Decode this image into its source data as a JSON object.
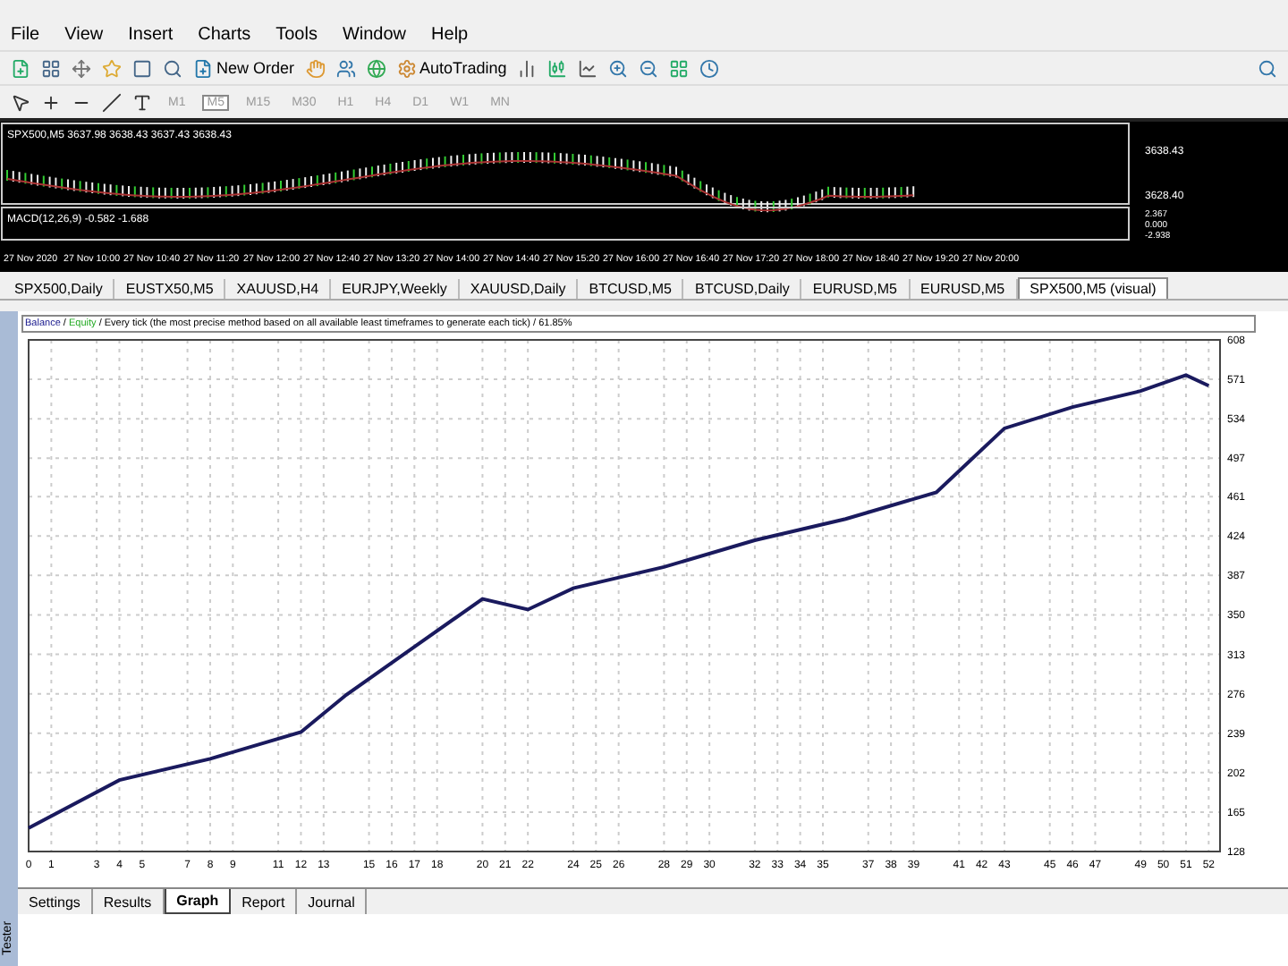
{
  "menu": [
    "File",
    "View",
    "Insert",
    "Charts",
    "Tools",
    "Window",
    "Help"
  ],
  "toolbar": {
    "new_order": "New Order",
    "autotrading": "AutoTrading"
  },
  "timeframes": [
    {
      "label": "M1",
      "selected": false
    },
    {
      "label": "M5",
      "selected": true
    },
    {
      "label": "M15",
      "selected": false
    },
    {
      "label": "M30",
      "selected": false
    },
    {
      "label": "H1",
      "selected": false
    },
    {
      "label": "H4",
      "selected": false
    },
    {
      "label": "D1",
      "selected": false
    },
    {
      "label": "W1",
      "selected": false
    },
    {
      "label": "MN",
      "selected": false
    }
  ],
  "price_chart": {
    "header": "SPX500,M5  3637.98 3638.43 3637.43 3638.43",
    "price_labels": [
      "3638.43",
      "3628.40"
    ],
    "indicator_header": "MACD(12,26,9) -0.582 -1.688",
    "indicator_labels": [
      "2.367",
      "0.000",
      "-2.938"
    ],
    "time_labels": [
      "27 Nov 2020",
      "27 Nov 10:00",
      "27 Nov 10:40",
      "27 Nov 11:20",
      "27 Nov 12:00",
      "27 Nov 12:40",
      "27 Nov 13:20",
      "27 Nov 14:00",
      "27 Nov 14:40",
      "27 Nov 15:20",
      "27 Nov 16:00",
      "27 Nov 16:40",
      "27 Nov 17:20",
      "27 Nov 18:00",
      "27 Nov 18:40",
      "27 Nov 19:20",
      "27 Nov 20:00"
    ]
  },
  "chart_tabs": [
    {
      "label": "SPX500,Daily",
      "selected": false
    },
    {
      "label": "EUSTX50,M5",
      "selected": false
    },
    {
      "label": "XAUUSD,H4",
      "selected": false
    },
    {
      "label": "EURJPY,Weekly",
      "selected": false
    },
    {
      "label": "XAUUSD,Daily",
      "selected": false
    },
    {
      "label": "BTCUSD,M5",
      "selected": false
    },
    {
      "label": "BTCUSD,Daily",
      "selected": false
    },
    {
      "label": "EURUSD,M5",
      "selected": false
    },
    {
      "label": "EURUSD,M5",
      "selected": false
    },
    {
      "label": "SPX500,M5 (visual)",
      "selected": true
    }
  ],
  "tester": {
    "side_label": "Tester",
    "graph_header": {
      "separator": "/",
      "equity": "Equity",
      "text": "/ Every tick (the most precise method based on all available least timeframes to generate each tick) / 61.85%"
    },
    "chart_data": {
      "type": "line",
      "x": [
        0,
        4,
        8,
        12,
        14,
        17,
        20,
        22,
        24,
        28,
        32,
        36,
        40,
        43,
        46,
        49,
        51,
        52
      ],
      "series": [
        {
          "name": "Balance",
          "color": "#1a1a5e",
          "values": [
            150,
            195,
            215,
            240,
            275,
            320,
            365,
            355,
            375,
            395,
            420,
            440,
            465,
            525,
            545,
            560,
            575,
            565
          ]
        }
      ],
      "xlim": [
        0,
        52.5
      ],
      "ylim": [
        128,
        608
      ],
      "grid": true,
      "xticks": [
        0,
        1,
        3,
        4,
        5,
        7,
        8,
        9,
        11,
        12,
        13,
        15,
        16,
        17,
        18,
        20,
        21,
        22,
        24,
        25,
        26,
        28,
        29,
        30,
        32,
        33,
        34,
        35,
        37,
        38,
        39,
        41,
        42,
        43,
        45,
        46,
        47,
        49,
        50,
        51,
        52
      ],
      "yticks": [
        608,
        571,
        534,
        497,
        461,
        424,
        387,
        350,
        313,
        276,
        239,
        202,
        165,
        128
      ]
    },
    "tabs": [
      {
        "label": "Settings",
        "selected": false
      },
      {
        "label": "Results",
        "selected": false
      },
      {
        "label": "Graph",
        "selected": true
      },
      {
        "label": "Report",
        "selected": false
      },
      {
        "label": "Journal",
        "selected": false
      }
    ]
  }
}
